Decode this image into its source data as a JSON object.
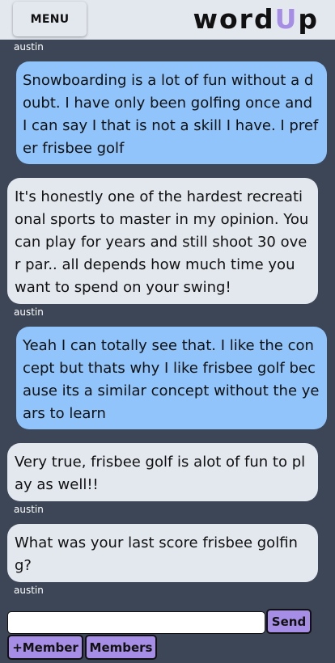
{
  "header": {
    "menu_label": "MENU",
    "logo_pre": "word",
    "logo_accent": "U",
    "logo_post": "p"
  },
  "messages": [
    {
      "author": "austin",
      "text": "Snowboarding is a lot of fun without a doubt. I have only been golfing once and I can say I that is not a skill I have. I prefer frisbee golf"
    },
    {
      "text": "It's honestly one of the hardest recreational sports to master in my opinion. You can play for years and still shoot 30 over par.. all depends how much time you want to spend on your swing!"
    },
    {
      "author": "austin",
      "text": "Yeah I can totally see that. I like the concept but thats why I like frisbee golf because its a similar concept without the years to learn"
    },
    {
      "text": "Very true, frisbee golf is alot of fun to play as well!!"
    },
    {
      "author": "austin",
      "text": "What was your last score frisbee golfing?"
    },
    {
      "author": "austin"
    }
  ],
  "composer": {
    "input_value": "",
    "send_label": "Send",
    "add_member_label": "+Member",
    "members_label": "Members"
  },
  "colors": {
    "background": "#3c4657",
    "sent_bubble": "#90c4fb",
    "received_bubble": "#e3e8ef",
    "accent": "#a68ee6"
  }
}
